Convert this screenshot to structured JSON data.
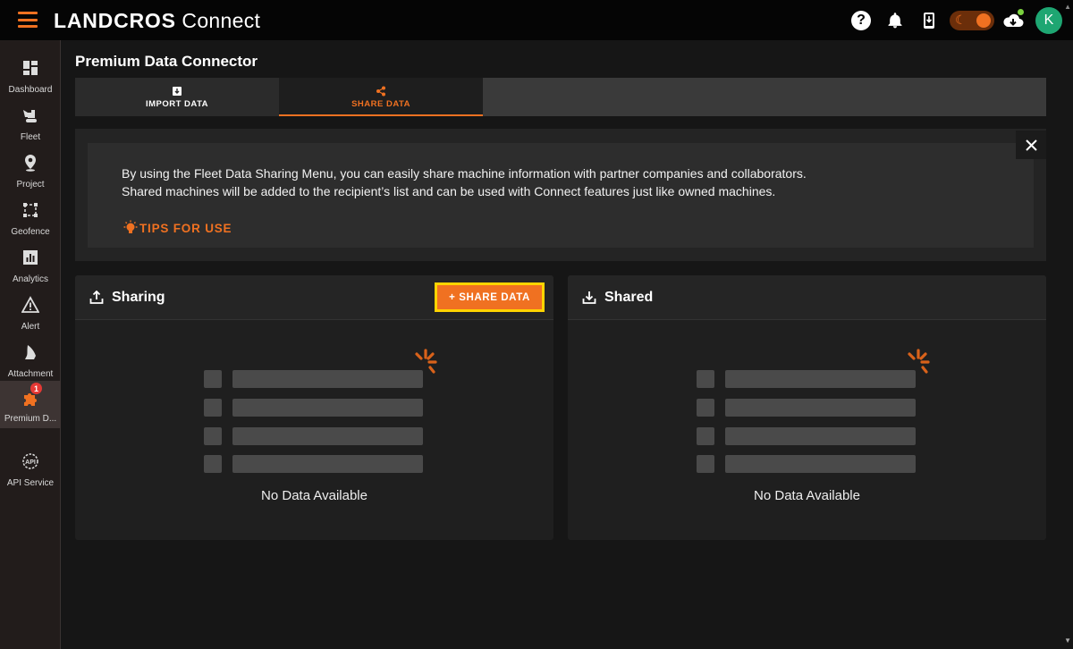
{
  "header": {
    "brand_bold": "LANDCROS",
    "brand_light": " Connect",
    "help_glyph": "?",
    "avatar_initial": "K"
  },
  "sidebar": {
    "items": [
      {
        "label": "Dashboard",
        "icon": "dashboard-icon"
      },
      {
        "label": "Fleet",
        "icon": "excavator-icon"
      },
      {
        "label": "Project",
        "icon": "map-pin-icon"
      },
      {
        "label": "Geofence",
        "icon": "geofence-icon"
      },
      {
        "label": "Analytics",
        "icon": "analytics-icon"
      },
      {
        "label": "Alert",
        "icon": "warning-icon"
      },
      {
        "label": "Attachment",
        "icon": "attachment-icon"
      },
      {
        "label": "Premium D...",
        "icon": "puzzle-icon",
        "badge": "1"
      },
      {
        "label": "API Service",
        "icon": "api-icon"
      }
    ]
  },
  "page": {
    "title": "Premium Data Connector"
  },
  "tabs": [
    {
      "label": "IMPORT DATA",
      "icon": "import-icon"
    },
    {
      "label": "SHARE DATA",
      "icon": "share-icon"
    }
  ],
  "info": {
    "line1": "By using the Fleet Data Sharing Menu, you can easily share machine information with partner companies and collaborators.",
    "line2": "Shared machines will be added to the recipient’s list and can be used with Connect features just like owned machines.",
    "tips_label": "TIPS FOR USE"
  },
  "panels": {
    "sharing": {
      "title": "Sharing",
      "button": "+ SHARE DATA",
      "empty": "No Data Available"
    },
    "shared": {
      "title": "Shared",
      "empty": "No Data Available"
    }
  },
  "colors": {
    "accent": "#f07121",
    "highlight": "#ffd400",
    "avatar": "#1ea672"
  }
}
